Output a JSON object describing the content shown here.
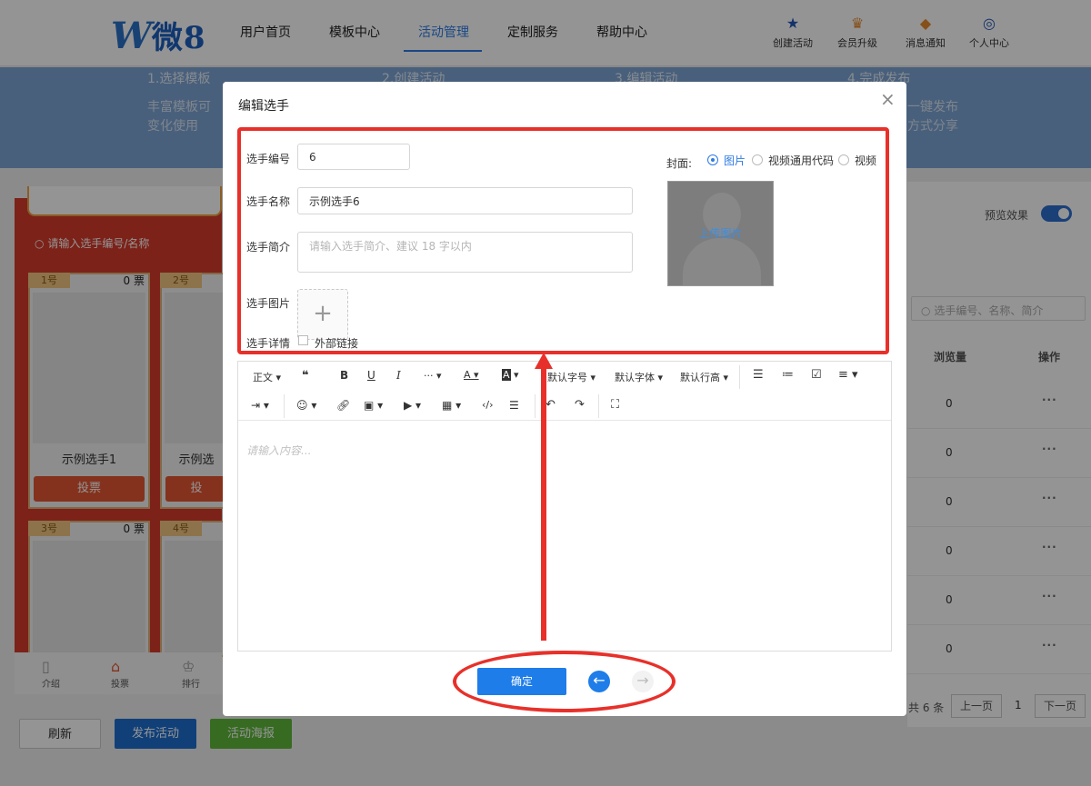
{
  "header": {
    "logo": {
      "w": "W",
      "text": "微8"
    },
    "nav": [
      "用户首页",
      "模板中心",
      "活动管理",
      "定制服务",
      "帮助中心"
    ],
    "active_nav": "活动管理",
    "icons": [
      {
        "label": "创建活动",
        "icon": "star-icon"
      },
      {
        "label": "会员升级",
        "icon": "crown-icon"
      },
      {
        "label": "消息通知",
        "icon": "bell-icon"
      },
      {
        "label": "个人中心",
        "icon": "user-icon"
      }
    ]
  },
  "banner": {
    "steps": [
      "1.选择模板",
      "2.创建活动",
      "3.编辑活动",
      "4.完成发布"
    ],
    "sub_left": [
      "丰富模板可",
      "变化使用"
    ],
    "sub_right": [
      "一键发布",
      "方式分享"
    ]
  },
  "preview": {
    "search_placeholder": "请输入选手编号/名称",
    "cards": [
      {
        "num": "1号",
        "votes": "0 票",
        "name": "示例选手1",
        "vote_label": "投票"
      },
      {
        "num": "2号",
        "votes": "",
        "name": "示例选",
        "vote_label": "投"
      },
      {
        "num": "3号",
        "votes": "0 票"
      },
      {
        "num": "4号",
        "votes": ""
      }
    ],
    "bottom_nav": [
      "介绍",
      "投票",
      "排行"
    ]
  },
  "right_panel": {
    "preview_effect": "预览效果",
    "search_placeholder": "选手编号、名称、简介",
    "col_views": "浏览量",
    "col_actions": "操作",
    "rows": [
      {
        "views": "0",
        "action": "···"
      },
      {
        "views": "0",
        "action": "···"
      },
      {
        "views": "0",
        "action": "···"
      },
      {
        "views": "0",
        "action": "···"
      },
      {
        "views": "0",
        "action": "···"
      },
      {
        "views": "0",
        "action": "···"
      }
    ],
    "pagination": {
      "total": "共 6 条",
      "prev": "上一页",
      "page": "1",
      "next": "下一页"
    }
  },
  "bottom_buttons": {
    "refresh": "刷新",
    "publish": "发布活动",
    "poster": "活动海报"
  },
  "dialog": {
    "title": "编辑选手",
    "close": "×",
    "fields": {
      "number_label": "选手编号",
      "number_value": "6",
      "name_label": "选手名称",
      "name_value": "示例选手6",
      "intro_label": "选手简介",
      "intro_placeholder": "请输入选手简介、建议 18 字以内",
      "image_label": "选手图片",
      "detail_label": "选手详情",
      "external_link": "外部链接"
    },
    "cover": {
      "label": "封面:",
      "options": [
        "图片",
        "视频通用代码",
        "视频"
      ],
      "selected": "图片",
      "upload_text": "上传图片"
    },
    "editor": {
      "toolbar_row1": [
        "正文",
        "❝",
        "B",
        "U",
        "I",
        "···",
        "A",
        "A",
        "默认字号",
        "默认字体",
        "默认行高"
      ],
      "placeholder": "请输入内容..."
    },
    "confirm": "确定"
  },
  "colors": {
    "accent": "#1e7de9",
    "annotation": "#e8302a"
  }
}
